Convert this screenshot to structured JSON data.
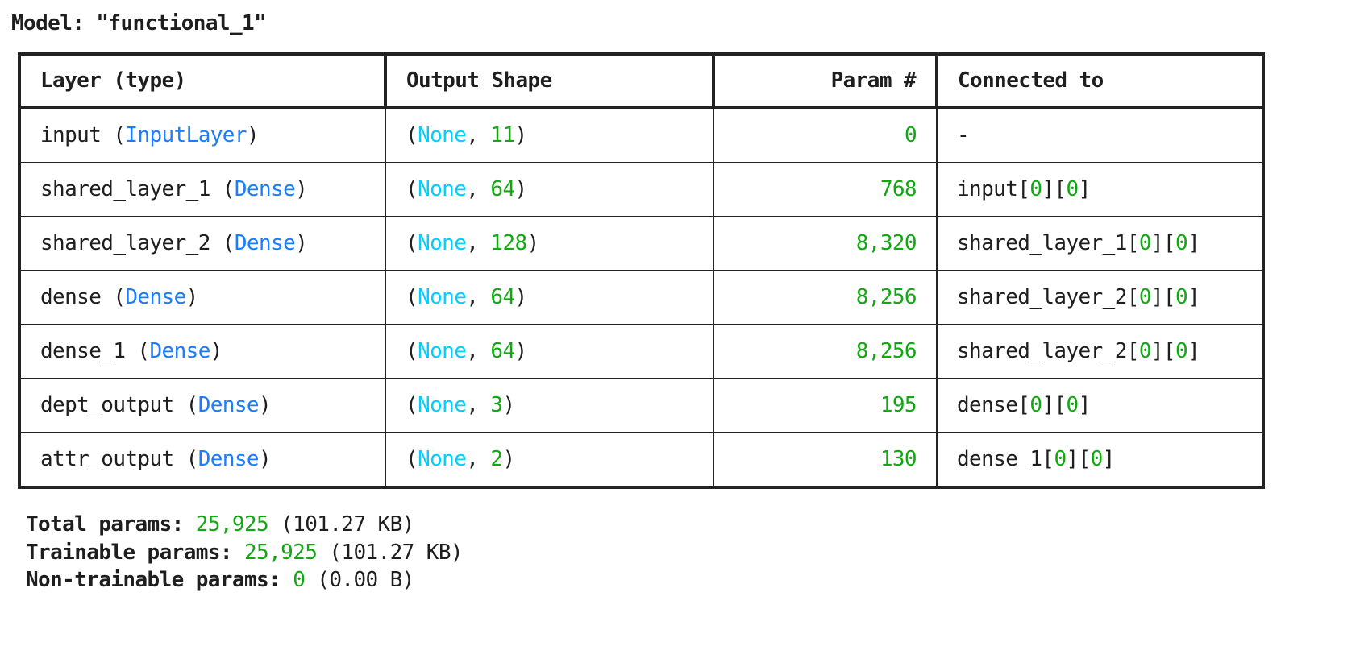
{
  "title": "Model: \"functional_1\"",
  "colors": {
    "type": "#1a7cff",
    "none": "#00cfff",
    "number": "#11a811",
    "text": "#1e1e1e"
  },
  "headers": [
    "Layer (type)",
    "Output Shape",
    "Param #",
    "Connected to"
  ],
  "rows": [
    {
      "layer": [
        [
          "input (",
          ""
        ],
        [
          "InputLayer",
          "type"
        ],
        [
          ")",
          ""
        ]
      ],
      "shape": [
        [
          "(",
          ""
        ],
        [
          "None",
          "none"
        ],
        [
          ", ",
          ""
        ],
        [
          "11",
          "number"
        ],
        [
          ")",
          ""
        ]
      ],
      "params": "0",
      "connected": [
        [
          "-",
          ""
        ]
      ]
    },
    {
      "layer": [
        [
          "shared_layer_1 (",
          ""
        ],
        [
          "Dense",
          "type"
        ],
        [
          ")",
          ""
        ]
      ],
      "shape": [
        [
          "(",
          ""
        ],
        [
          "None",
          "none"
        ],
        [
          ", ",
          ""
        ],
        [
          "64",
          "number"
        ],
        [
          ")",
          ""
        ]
      ],
      "params": "768",
      "connected": [
        [
          "input[",
          ""
        ],
        [
          "0",
          "number"
        ],
        [
          "][",
          ""
        ],
        [
          "0",
          "number"
        ],
        [
          "]",
          ""
        ]
      ]
    },
    {
      "layer": [
        [
          "shared_layer_2 (",
          ""
        ],
        [
          "Dense",
          "type"
        ],
        [
          ")",
          ""
        ]
      ],
      "shape": [
        [
          "(",
          ""
        ],
        [
          "None",
          "none"
        ],
        [
          ", ",
          ""
        ],
        [
          "128",
          "number"
        ],
        [
          ")",
          ""
        ]
      ],
      "params": "8,320",
      "connected": [
        [
          "shared_layer_1[",
          ""
        ],
        [
          "0",
          "number"
        ],
        [
          "][",
          ""
        ],
        [
          "0",
          "number"
        ],
        [
          "]",
          ""
        ]
      ]
    },
    {
      "layer": [
        [
          "dense (",
          ""
        ],
        [
          "Dense",
          "type"
        ],
        [
          ")",
          ""
        ]
      ],
      "shape": [
        [
          "(",
          ""
        ],
        [
          "None",
          "none"
        ],
        [
          ", ",
          ""
        ],
        [
          "64",
          "number"
        ],
        [
          ")",
          ""
        ]
      ],
      "params": "8,256",
      "connected": [
        [
          "shared_layer_2[",
          ""
        ],
        [
          "0",
          "number"
        ],
        [
          "][",
          ""
        ],
        [
          "0",
          "number"
        ],
        [
          "]",
          ""
        ]
      ]
    },
    {
      "layer": [
        [
          "dense_1 (",
          ""
        ],
        [
          "Dense",
          "type"
        ],
        [
          ")",
          ""
        ]
      ],
      "shape": [
        [
          "(",
          ""
        ],
        [
          "None",
          "none"
        ],
        [
          ", ",
          ""
        ],
        [
          "64",
          "number"
        ],
        [
          ")",
          ""
        ]
      ],
      "params": "8,256",
      "connected": [
        [
          "shared_layer_2[",
          ""
        ],
        [
          "0",
          "number"
        ],
        [
          "][",
          ""
        ],
        [
          "0",
          "number"
        ],
        [
          "]",
          ""
        ]
      ]
    },
    {
      "layer": [
        [
          "dept_output (",
          ""
        ],
        [
          "Dense",
          "type"
        ],
        [
          ")",
          ""
        ]
      ],
      "shape": [
        [
          "(",
          ""
        ],
        [
          "None",
          "none"
        ],
        [
          ", ",
          ""
        ],
        [
          "3",
          "number"
        ],
        [
          ")",
          ""
        ]
      ],
      "params": "195",
      "connected": [
        [
          "dense[",
          ""
        ],
        [
          "0",
          "number"
        ],
        [
          "][",
          ""
        ],
        [
          "0",
          "number"
        ],
        [
          "]",
          ""
        ]
      ]
    },
    {
      "layer": [
        [
          "attr_output (",
          ""
        ],
        [
          "Dense",
          "type"
        ],
        [
          ")",
          ""
        ]
      ],
      "shape": [
        [
          "(",
          ""
        ],
        [
          "None",
          "none"
        ],
        [
          ", ",
          ""
        ],
        [
          "2",
          "number"
        ],
        [
          ")",
          ""
        ]
      ],
      "params": "130",
      "connected": [
        [
          "dense_1[",
          ""
        ],
        [
          "0",
          "number"
        ],
        [
          "][",
          ""
        ],
        [
          "0",
          "number"
        ],
        [
          "]",
          ""
        ]
      ]
    }
  ],
  "summary": [
    {
      "label": "Total params: ",
      "value": "25,925",
      "size": " (101.27 KB)"
    },
    {
      "label": "Trainable params: ",
      "value": "25,925",
      "size": " (101.27 KB)"
    },
    {
      "label": "Non-trainable params: ",
      "value": "0",
      "size": " (0.00 B)"
    }
  ]
}
